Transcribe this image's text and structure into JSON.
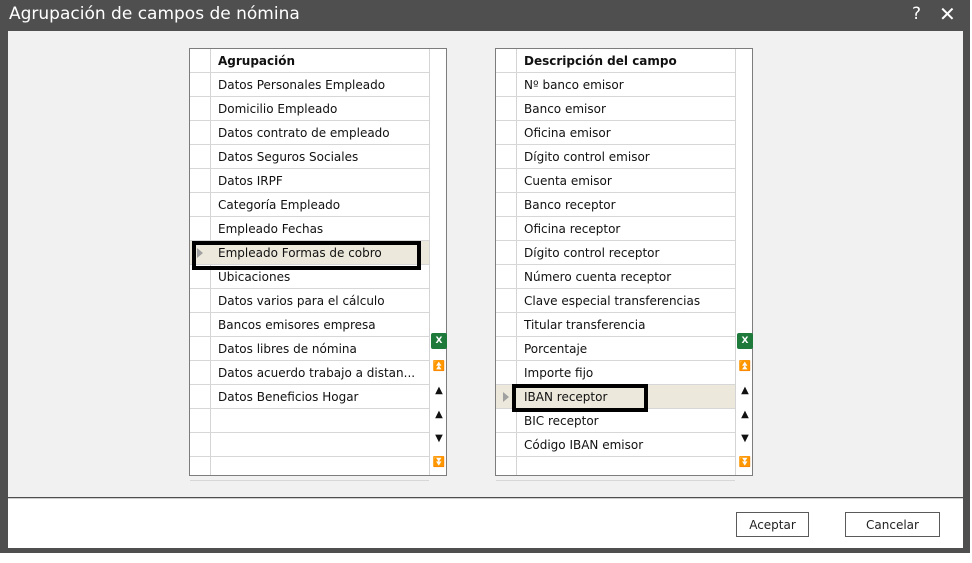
{
  "title": "Agrupación de campos de nómina",
  "help_label": "?",
  "close_label": "✕",
  "left_grid": {
    "header": "Agrupación",
    "rows": [
      "Datos Personales Empleado",
      "Domicilio Empleado",
      "Datos contrato de empleado",
      "Datos Seguros Sociales",
      "Datos IRPF",
      "Categoría Empleado",
      "Empleado Fechas",
      "Empleado Formas de cobro",
      "Ubicaciones",
      "Datos varios para el cálculo",
      "Bancos emisores empresa",
      "Datos libres de nómina",
      "Datos acuerdo trabajo a distan...",
      "Datos Beneficios Hogar",
      "",
      "",
      ""
    ],
    "selected_index": 7
  },
  "right_grid": {
    "header": "Descripción del campo",
    "rows": [
      "Nº banco emisor",
      "Banco emisor",
      "Oficina emisor",
      "Dígito control emisor",
      "Cuenta emisor",
      "Banco receptor",
      "Oficina receptor",
      "Dígito control receptor",
      "Número cuenta receptor",
      "Clave especial transferencias",
      "Titular transferencia",
      "Porcentaje",
      "Importe fijo",
      "IBAN receptor",
      "BIC receptor",
      "Código IBAN emisor",
      ""
    ],
    "selected_index": 13
  },
  "excel_icon_label": "X",
  "scroll_glyphs": [
    "⏫",
    "▲",
    "▲",
    "▼",
    "⏬",
    "⏬"
  ],
  "buttons": {
    "ok": "Aceptar",
    "cancel": "Cancelar"
  },
  "colors": {
    "titlebar": "#4f4f4f",
    "selected_row": "#ece8dc",
    "excel_green": "#1d7a3b"
  }
}
